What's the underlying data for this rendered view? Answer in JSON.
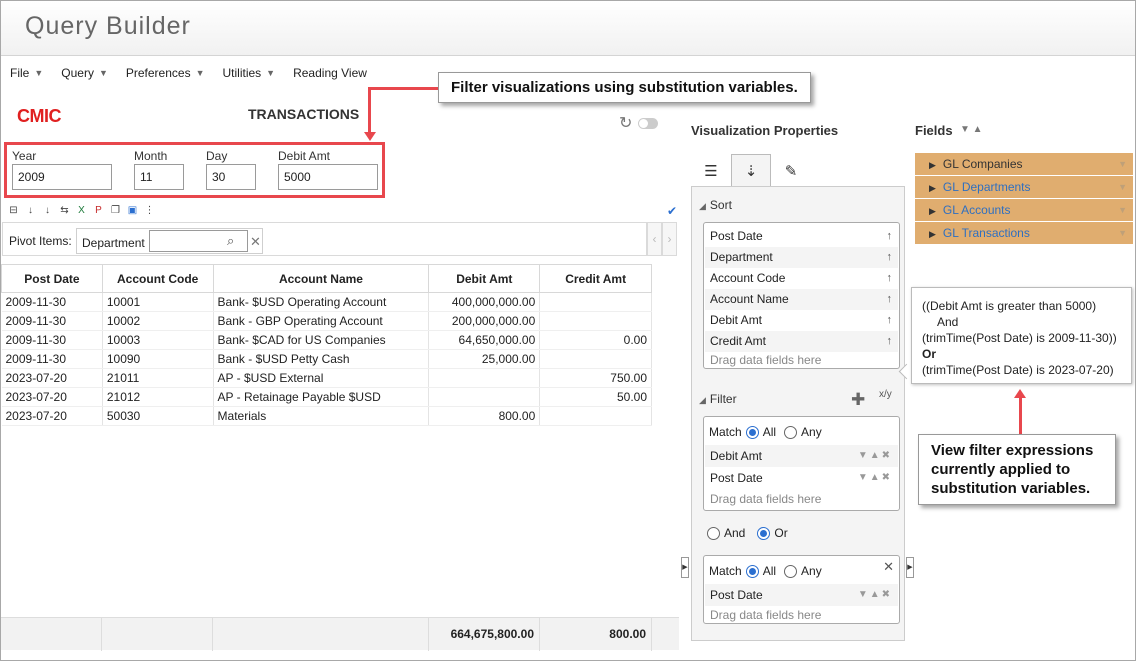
{
  "app": {
    "title": "Query Builder"
  },
  "menu": [
    {
      "label": "File",
      "has_caret": true
    },
    {
      "label": "Query",
      "has_caret": true
    },
    {
      "label": "Preferences",
      "has_caret": true
    },
    {
      "label": "Utilities",
      "has_caret": true
    },
    {
      "label": "Reading View",
      "has_caret": false
    }
  ],
  "logo": {
    "prefix": "CM",
    "suffix": "C"
  },
  "report": {
    "title": "TRANSACTIONS"
  },
  "substitution": [
    {
      "label": "Year",
      "value": "2009"
    },
    {
      "label": "Month",
      "value": "11"
    },
    {
      "label": "Day",
      "value": "30"
    },
    {
      "label": "Debit Amt",
      "value": "5000"
    }
  ],
  "pivot": {
    "label": "Pivot Items:",
    "item": "Department",
    "value": ""
  },
  "grid": {
    "columns": [
      "Post Date",
      "Account Code",
      "Account Name",
      "Debit Amt",
      "Credit Amt"
    ],
    "rows": [
      [
        "2009-11-30",
        "10001",
        "Bank- $USD Operating Account",
        "400,000,000.00",
        ""
      ],
      [
        "2009-11-30",
        "10002",
        "Bank - GBP Operating Account",
        "200,000,000.00",
        ""
      ],
      [
        "2009-11-30",
        "10003",
        "Bank- $CAD for US Companies",
        "64,650,000.00",
        "0.00"
      ],
      [
        "2009-11-30",
        "10090",
        "Bank - $USD Petty Cash",
        "25,000.00",
        ""
      ],
      [
        "2023-07-20",
        "21011",
        "AP - $USD External",
        "",
        "750.00"
      ],
      [
        "2023-07-20",
        "21012",
        "AP - Retainage Payable $USD",
        "",
        "50.00"
      ],
      [
        "2023-07-20",
        "50030",
        "Materials",
        "800.00",
        ""
      ]
    ],
    "totals": {
      "debit": "664,675,800.00",
      "credit": "800.00"
    }
  },
  "viz": {
    "title": "Visualization Properties",
    "sort": {
      "label": "Sort",
      "items": [
        "Post Date",
        "Department",
        "Account Code",
        "Account Name",
        "Debit Amt",
        "Credit Amt"
      ],
      "arrow": "↑",
      "drag_hint": "Drag data fields here"
    },
    "filter": {
      "label": "Filter",
      "match_label": "Match",
      "all_label": "All",
      "any_label": "Any",
      "group1": [
        "Debit Amt",
        "Post Date"
      ],
      "and_label": "And",
      "or_label": "Or",
      "group2": [
        "Post Date"
      ],
      "drag_hint": "Drag data fields here"
    }
  },
  "fields": {
    "title": "Fields",
    "items": [
      "GL Companies",
      "GL Departments",
      "GL Accounts",
      "GL Transactions"
    ]
  },
  "tooltip": {
    "line1": "((Debit Amt is greater than 5000)",
    "line2": "And",
    "line3": "(trimTime(Post Date) is 2009-11-30))",
    "line4": "Or",
    "line5": "(trimTime(Post Date) is 2023-07-20)"
  },
  "callouts": {
    "top": "Filter visualizations using substitution variables.",
    "right_line1": "View filter expressions",
    "right_line2": "currently applied to",
    "right_line3": "substitution variables."
  },
  "colors": {
    "accent": "#2b6fd0",
    "highlight": "#e8474d",
    "field_bg": "#e0ad6f",
    "logo": "#e02020"
  }
}
